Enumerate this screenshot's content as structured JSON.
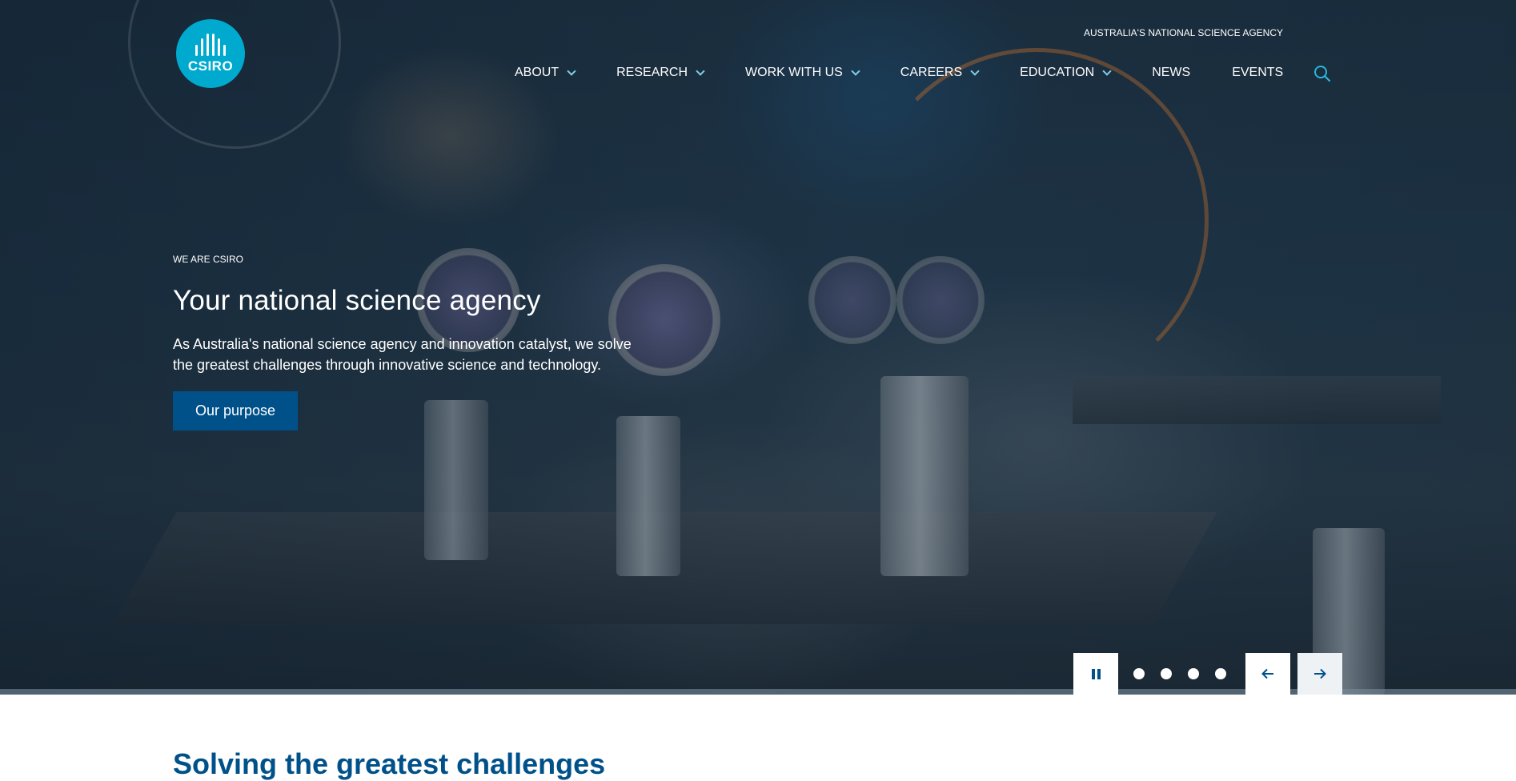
{
  "header": {
    "logo_text": "CSIRO",
    "tagline": "AUSTRALIA'S NATIONAL SCIENCE AGENCY",
    "nav": [
      {
        "label": "ABOUT",
        "has_dropdown": true
      },
      {
        "label": "RESEARCH",
        "has_dropdown": true
      },
      {
        "label": "WORK WITH US",
        "has_dropdown": true
      },
      {
        "label": "CAREERS",
        "has_dropdown": true
      },
      {
        "label": "EDUCATION",
        "has_dropdown": true
      },
      {
        "label": "NEWS",
        "has_dropdown": false
      },
      {
        "label": "EVENTS",
        "has_dropdown": false
      }
    ],
    "search_icon": "search-icon"
  },
  "hero": {
    "eyebrow": "WE ARE CSIRO",
    "headline": "Your national science agency",
    "description": "As Australia's national science agency and innovation catalyst, we solve the greatest challenges through innovative science and technology.",
    "cta_label": "Our purpose",
    "carousel": {
      "pause_icon": "pause-icon",
      "slide_count": 4,
      "prev_icon": "arrow-left-icon",
      "next_icon": "arrow-right-icon"
    }
  },
  "next_section": {
    "heading_partial": "Solving the greatest challenges"
  },
  "colors": {
    "brand_cyan": "#00a9ce",
    "brand_blue": "#00518a",
    "white": "#ffffff"
  }
}
